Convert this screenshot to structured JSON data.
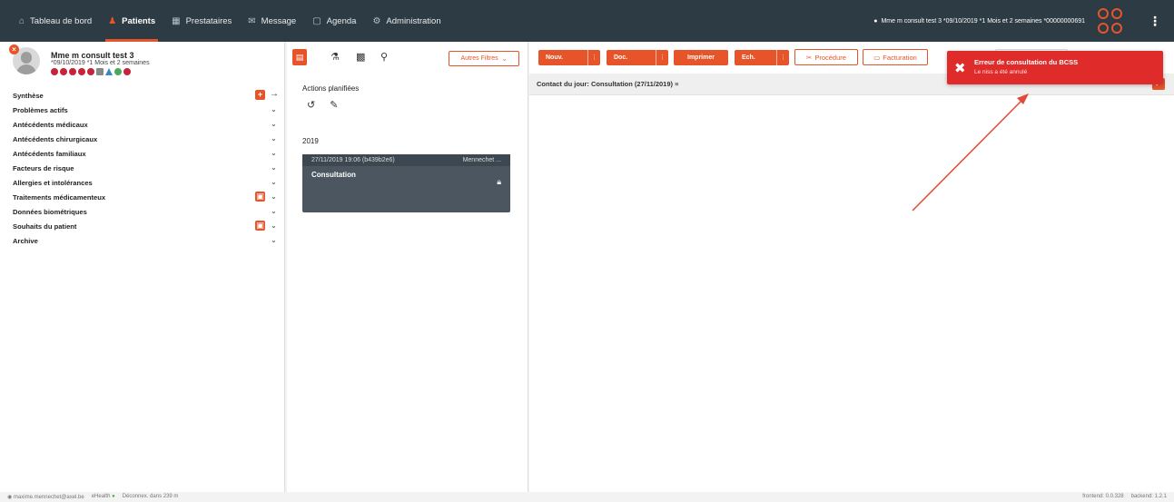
{
  "nav": {
    "items": [
      {
        "label": "Tableau de bord",
        "icon": "home-icon"
      },
      {
        "label": "Patients",
        "icon": "user-icon",
        "active": true
      },
      {
        "label": "Prestataires",
        "icon": "provider-icon"
      },
      {
        "label": "Message",
        "icon": "mail-icon"
      },
      {
        "label": "Agenda",
        "icon": "calendar-icon"
      },
      {
        "label": "Administration",
        "icon": "gear-icon"
      }
    ],
    "user_info": "Mme m consult test 3 *09/10/2019 *1 Mois et 2 semaines *00000000691"
  },
  "patient": {
    "name": "Mme m consult test 3",
    "info": "*09/10/2019 *1 Mois et 2 semaines"
  },
  "sections": [
    {
      "label": "Synthèse",
      "action": "+",
      "arrow": "→"
    },
    {
      "label": "Problèmes actifs"
    },
    {
      "label": "Antécédents médicaux"
    },
    {
      "label": "Antécédents chirurgicaux"
    },
    {
      "label": "Antécédents familiaux"
    },
    {
      "label": "Facteurs de risque"
    },
    {
      "label": "Allergies et intolérances"
    },
    {
      "label": "Traitements médicamenteux",
      "action": "▣"
    },
    {
      "label": "Données biométriques"
    },
    {
      "label": "Souhaits du patient",
      "action": "▣"
    },
    {
      "label": "Archive"
    }
  ],
  "middle": {
    "filter_label": "Autres Filtres",
    "title": "Actions planifiées",
    "year": "2019",
    "card": {
      "datetime": "27/11/2019 19:06 (b439b2e6)",
      "author": "Mennechet ...",
      "title": "Consultation"
    }
  },
  "toolbar": {
    "nouv": "Nouv.",
    "doc": "Doc.",
    "imprimer": "Imprimer",
    "ech": "Ech.",
    "procedure": "Procédure",
    "facturation": "Facturation"
  },
  "contact": {
    "label": "Contact du jour: Consultation (27/11/2019)"
  },
  "toast": {
    "title": "Erreur de consultation du BCSS",
    "text": "Le niss a été annulé"
  },
  "footer": {
    "email": "maxime.mennechet@axel.be",
    "ehealth": "eHealth",
    "logout": "Déconnex. dans 239 m",
    "frontend": "frontend: 0.0.328",
    "backend": "backend: 1.2.1"
  },
  "colors": {
    "accent": "#e8542a",
    "topbar": "#2d3b44",
    "toast": "#e02b2b",
    "card": "#4b5660"
  }
}
